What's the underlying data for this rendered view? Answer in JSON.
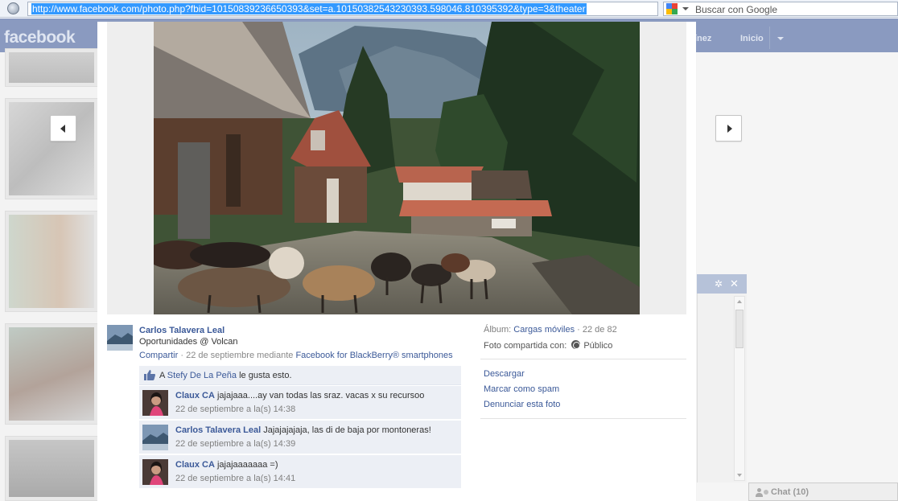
{
  "browser": {
    "address": "http://www.facebook.com/photo.php?fbid=10150839236650393&set=a.10150382543230393.598046.810395392&type=3&theater",
    "search_placeholder": "Buscar con Google"
  },
  "header": {
    "logo": "facebook",
    "name_partial": "rtínez",
    "home": "Inicio"
  },
  "photo": {
    "owner": "Carlos Talavera Leal",
    "caption": "Oportunidades @ Volcan",
    "share": "Compartir",
    "meta_prefix": " · 22 de septiembre mediante ",
    "app": "Facebook for BlackBerry® smartphones"
  },
  "likes": {
    "prefix": "A ",
    "person": "Stefy De La Peña",
    "suffix": " le gusta esto."
  },
  "comments": [
    {
      "author": "Claux CA",
      "text": " jajajaaa....ay van todas las sraz. vacas x su recursoo",
      "time": "22 de septiembre a la(s) 14:38"
    },
    {
      "author": "Carlos Talavera Leal",
      "text": " Jajajajajaja, las di de baja por montoneras!",
      "time": "22 de septiembre a la(s) 14:39"
    },
    {
      "author": "Claux CA",
      "text": " jajajaaaaaaa =)",
      "time": "22 de septiembre a la(s) 14:41"
    }
  ],
  "sidebar": {
    "album_label": "Álbum: ",
    "album_name": "Cargas móviles",
    "album_position": " · 22 de 82",
    "shared_label": "Foto compartida con:",
    "privacy": "Público",
    "actions": [
      "Descargar",
      "Marcar como spam",
      "Denunciar esta foto"
    ]
  },
  "chat": {
    "label": "Chat (10)",
    "gear": "✲",
    "close": "✕"
  },
  "colors": {
    "link": "#3b5998",
    "header_bg": "#8a9ac0",
    "comment_bg": "#eceff5",
    "address_highlight": "#3399ff"
  }
}
